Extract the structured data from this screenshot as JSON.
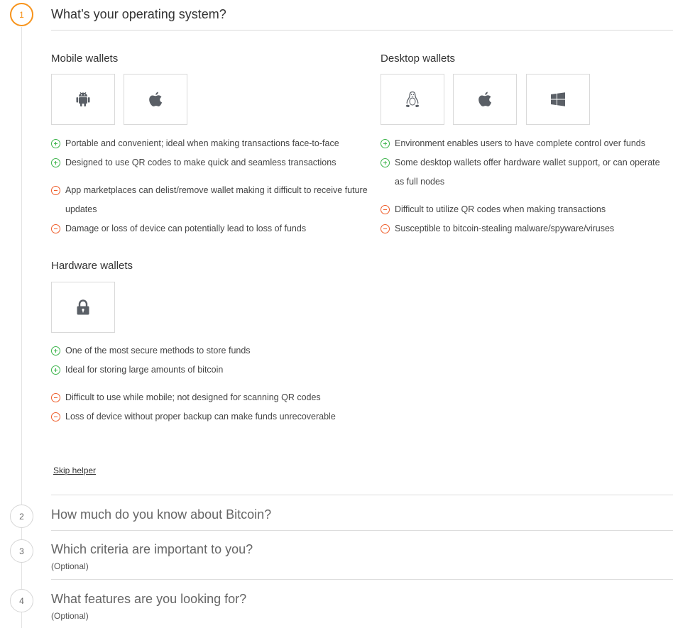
{
  "steps": [
    {
      "number": "1",
      "title": "What’s your operating system?"
    },
    {
      "number": "2",
      "title": "How much do you know about Bitcoin?"
    },
    {
      "number": "3",
      "title": "Which criteria are important to you?",
      "subtitle": "(Optional)"
    },
    {
      "number": "4",
      "title": "What features are you looking for?",
      "subtitle": "(Optional)"
    }
  ],
  "mobile": {
    "heading": "Mobile wallets",
    "platforms": [
      "android-icon",
      "apple-icon"
    ],
    "pros": [
      "Portable and convenient; ideal when making transactions face-to-face",
      "Designed to use QR codes to make quick and seamless transactions"
    ],
    "cons": [
      "App marketplaces can delist/remove wallet making it difficult to receive future updates",
      "Damage or loss of device can potentially lead to loss of funds"
    ]
  },
  "desktop": {
    "heading": "Desktop wallets",
    "platforms": [
      "linux-icon",
      "apple-icon",
      "windows-icon"
    ],
    "pros": [
      "Environment enables users to have complete control over funds",
      "Some desktop wallets offer hardware wallet support, or can operate as full nodes"
    ],
    "cons": [
      "Difficult to utilize QR codes when making transactions",
      "Susceptible to bitcoin-stealing malware/spyware/viruses"
    ]
  },
  "hardware": {
    "heading": "Hardware wallets",
    "platforms": [
      "lock-icon"
    ],
    "pros": [
      "One of the most secure methods to store funds",
      "Ideal for storing large amounts of bitcoin"
    ],
    "cons": [
      "Difficult to use while mobile; not designed for scanning QR codes",
      "Loss of device without proper backup can make funds unrecoverable"
    ]
  },
  "skip_label": "Skip helper",
  "colors": {
    "accent": "#f7931a",
    "pro": "#3bb44a",
    "con": "#ef5d2a",
    "icon": "#5a5f66"
  }
}
